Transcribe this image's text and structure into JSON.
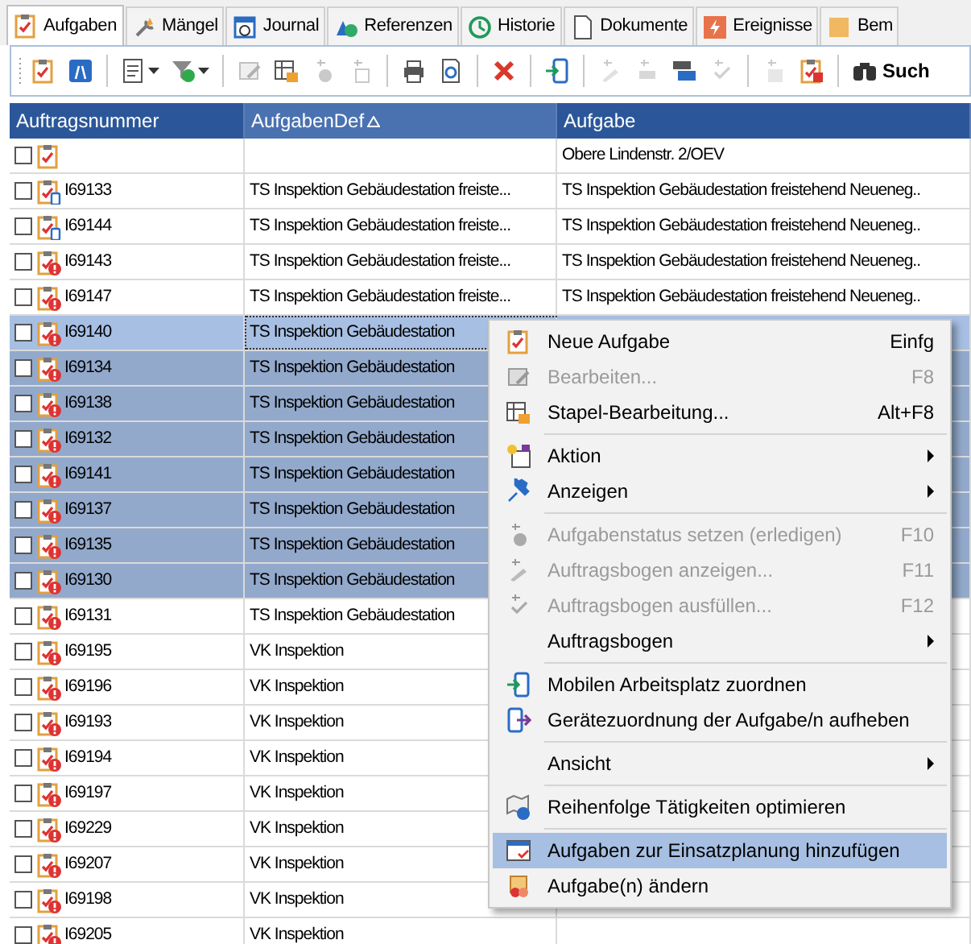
{
  "tabs": [
    {
      "label": "Aufgaben",
      "selected": true
    },
    {
      "label": "Mängel",
      "selected": false
    },
    {
      "label": "Journal",
      "selected": false
    },
    {
      "label": "Referenzen",
      "selected": false
    },
    {
      "label": "Historie",
      "selected": false
    },
    {
      "label": "Dokumente",
      "selected": false
    },
    {
      "label": "Ereignisse",
      "selected": false
    },
    {
      "label": "Bem",
      "selected": false
    }
  ],
  "toolbar": {
    "items": [
      {
        "kind": "button",
        "disabled": false
      },
      {
        "kind": "button",
        "disabled": false
      },
      {
        "kind": "separator"
      },
      {
        "kind": "dropdown",
        "disabled": false
      },
      {
        "kind": "dropdown",
        "disabled": false
      },
      {
        "kind": "separator"
      },
      {
        "kind": "button",
        "disabled": true
      },
      {
        "kind": "button",
        "disabled": false
      },
      {
        "kind": "button",
        "disabled": true
      },
      {
        "kind": "button",
        "disabled": true
      },
      {
        "kind": "separator"
      },
      {
        "kind": "button",
        "disabled": false
      },
      {
        "kind": "button",
        "disabled": false
      },
      {
        "kind": "separator"
      },
      {
        "kind": "button",
        "disabled": false
      },
      {
        "kind": "separator"
      },
      {
        "kind": "button",
        "disabled": false
      },
      {
        "kind": "separator"
      },
      {
        "kind": "button",
        "disabled": true
      },
      {
        "kind": "button",
        "disabled": true
      },
      {
        "kind": "button",
        "disabled": false
      },
      {
        "kind": "button",
        "disabled": true
      },
      {
        "kind": "separator"
      },
      {
        "kind": "button",
        "disabled": true
      },
      {
        "kind": "button",
        "disabled": false
      },
      {
        "kind": "separator"
      }
    ],
    "search_label": "Such"
  },
  "table": {
    "columns": [
      {
        "label": "Auftragsnummer",
        "sorted": false
      },
      {
        "label": "AufgabenDef",
        "sorted": true
      },
      {
        "label": "Aufgabe",
        "sorted": false
      }
    ],
    "rows": [
      {
        "kind": "task",
        "number": "",
        "definition": "",
        "task": "Obere Lindenstr. 2/OEV",
        "checked": false,
        "selected": false,
        "focused": false
      },
      {
        "kind": "mobile",
        "number": "I69133",
        "definition": "TS Inspektion Gebäudestation freiste...",
        "task": "TS Inspektion Gebäudestation freistehend Neueneg..",
        "checked": false,
        "selected": false,
        "focused": false
      },
      {
        "kind": "mobile",
        "number": "I69144",
        "definition": "TS Inspektion Gebäudestation freiste...",
        "task": "TS Inspektion Gebäudestation freistehend Neueneg..",
        "checked": false,
        "selected": false,
        "focused": false
      },
      {
        "kind": "alert",
        "number": "I69143",
        "definition": "TS Inspektion Gebäudestation freiste...",
        "task": "TS Inspektion Gebäudestation freistehend Neueneg..",
        "checked": false,
        "selected": false,
        "focused": false
      },
      {
        "kind": "alert",
        "number": "I69147",
        "definition": "TS Inspektion Gebäudestation freiste...",
        "task": "TS Inspektion Gebäudestation freistehend Neueneg..",
        "checked": false,
        "selected": false,
        "focused": false
      },
      {
        "kind": "alert",
        "number": "I69140",
        "definition": "TS Inspektion Gebäudestation",
        "task": "",
        "checked": false,
        "selected": true,
        "focused": true
      },
      {
        "kind": "alert",
        "number": "I69134",
        "definition": "TS Inspektion Gebäudestation",
        "task": "",
        "checked": false,
        "selected": true,
        "focused": false
      },
      {
        "kind": "alert",
        "number": "I69138",
        "definition": "TS Inspektion Gebäudestation",
        "task": "",
        "checked": false,
        "selected": true,
        "focused": false
      },
      {
        "kind": "alert",
        "number": "I69132",
        "definition": "TS Inspektion Gebäudestation",
        "task": "",
        "checked": false,
        "selected": true,
        "focused": false
      },
      {
        "kind": "alert",
        "number": "I69141",
        "definition": "TS Inspektion Gebäudestation",
        "task": "",
        "checked": false,
        "selected": true,
        "focused": false
      },
      {
        "kind": "alert",
        "number": "I69137",
        "definition": "TS Inspektion Gebäudestation",
        "task": "",
        "checked": false,
        "selected": true,
        "focused": false
      },
      {
        "kind": "alert",
        "number": "I69135",
        "definition": "TS Inspektion Gebäudestation",
        "task": "",
        "checked": false,
        "selected": true,
        "focused": false
      },
      {
        "kind": "alert",
        "number": "I69130",
        "definition": "TS Inspektion Gebäudestation",
        "task": "",
        "checked": false,
        "selected": true,
        "focused": false
      },
      {
        "kind": "alert",
        "number": "I69131",
        "definition": "TS Inspektion Gebäudestation",
        "task": "",
        "checked": false,
        "selected": false,
        "focused": false
      },
      {
        "kind": "alert",
        "number": "I69195",
        "definition": "VK Inspektion",
        "task": "",
        "checked": false,
        "selected": false,
        "focused": false
      },
      {
        "kind": "alert",
        "number": "I69196",
        "definition": "VK Inspektion",
        "task": "",
        "checked": false,
        "selected": false,
        "focused": false
      },
      {
        "kind": "alert",
        "number": "I69193",
        "definition": "VK Inspektion",
        "task": "",
        "checked": false,
        "selected": false,
        "focused": false
      },
      {
        "kind": "alert",
        "number": "I69194",
        "definition": "VK Inspektion",
        "task": "",
        "checked": false,
        "selected": false,
        "focused": false
      },
      {
        "kind": "alert",
        "number": "I69197",
        "definition": "VK Inspektion",
        "task": "",
        "checked": false,
        "selected": false,
        "focused": false
      },
      {
        "kind": "alert",
        "number": "I69229",
        "definition": "VK Inspektion",
        "task": "",
        "checked": false,
        "selected": false,
        "focused": false
      },
      {
        "kind": "alert",
        "number": "I69207",
        "definition": "VK Inspektion",
        "task": "",
        "checked": false,
        "selected": false,
        "focused": false
      },
      {
        "kind": "alert",
        "number": "I69198",
        "definition": "VK Inspektion",
        "task": "",
        "checked": false,
        "selected": false,
        "focused": false
      },
      {
        "kind": "alert",
        "number": "I69205",
        "definition": "VK Inspektion",
        "task": "",
        "checked": false,
        "selected": false,
        "focused": false
      }
    ]
  },
  "context_menu": [
    {
      "kind": "item",
      "label": "Neue Aufgabe",
      "shortcut": "Einfg",
      "disabled": false,
      "submenu": false,
      "selected": false
    },
    {
      "kind": "item",
      "label": "Bearbeiten...",
      "shortcut": "F8",
      "disabled": true,
      "submenu": false,
      "selected": false
    },
    {
      "kind": "item",
      "label": "Stapel-Bearbeitung...",
      "shortcut": "Alt+F8",
      "disabled": false,
      "submenu": false,
      "selected": false
    },
    {
      "kind": "separator"
    },
    {
      "kind": "item",
      "label": "Aktion",
      "disabled": false,
      "submenu": true,
      "selected": false
    },
    {
      "kind": "item",
      "label": "Anzeigen",
      "disabled": false,
      "submenu": true,
      "selected": false
    },
    {
      "kind": "separator"
    },
    {
      "kind": "item",
      "label": "Aufgabenstatus setzen (erledigen)",
      "shortcut": "F10",
      "disabled": true,
      "submenu": false,
      "selected": false
    },
    {
      "kind": "item",
      "label": "Auftragsbogen anzeigen...",
      "shortcut": "F11",
      "disabled": true,
      "submenu": false,
      "selected": false
    },
    {
      "kind": "item",
      "label": "Auftragsbogen ausfüllen...",
      "shortcut": "F12",
      "disabled": true,
      "submenu": false,
      "selected": false
    },
    {
      "kind": "item",
      "label": "Auftragsbogen",
      "disabled": false,
      "submenu": true,
      "selected": false
    },
    {
      "kind": "separator"
    },
    {
      "kind": "item",
      "label": "Mobilen Arbeitsplatz zuordnen",
      "disabled": false,
      "submenu": false,
      "selected": false
    },
    {
      "kind": "item",
      "label": "Gerätezuordnung der Aufgabe/n aufheben",
      "disabled": false,
      "submenu": false,
      "selected": false
    },
    {
      "kind": "separator"
    },
    {
      "kind": "item",
      "label": "Ansicht",
      "disabled": false,
      "submenu": true,
      "selected": false
    },
    {
      "kind": "separator"
    },
    {
      "kind": "item",
      "label": "Reihenfolge Tätigkeiten optimieren",
      "disabled": false,
      "submenu": false,
      "selected": false
    },
    {
      "kind": "separator"
    },
    {
      "kind": "item",
      "label": "Aufgaben zur Einsatzplanung hinzufügen",
      "disabled": false,
      "submenu": false,
      "selected": true
    },
    {
      "kind": "item",
      "label": "Aufgabe(n) ändern",
      "disabled": false,
      "submenu": false,
      "selected": false
    }
  ]
}
